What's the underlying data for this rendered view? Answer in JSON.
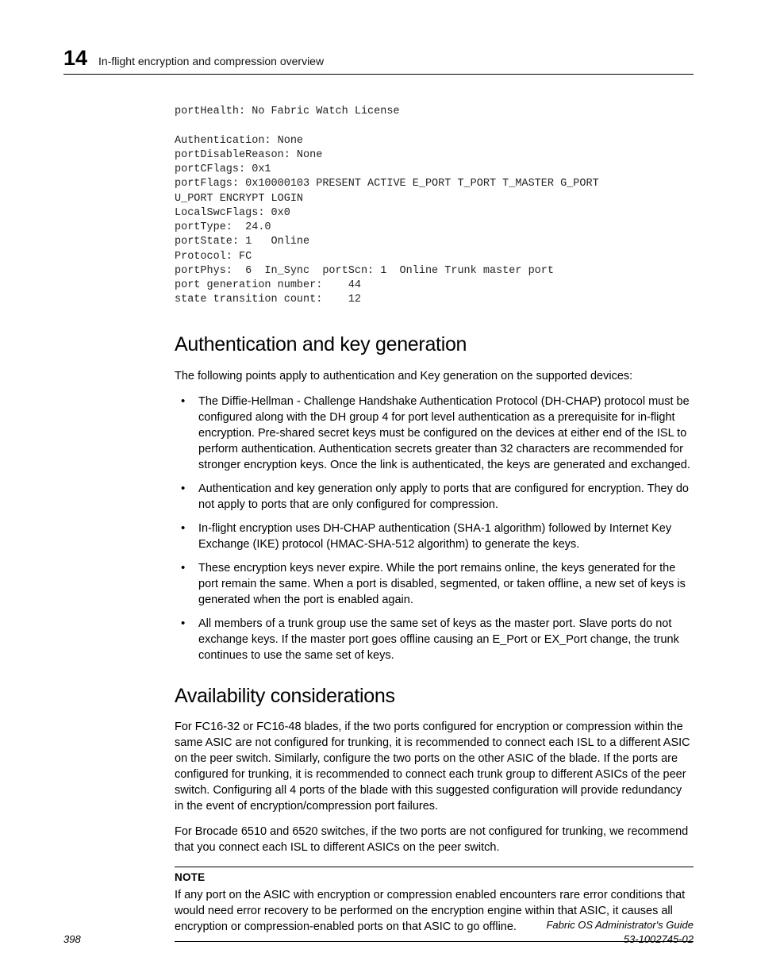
{
  "header": {
    "chapter_number": "14",
    "chapter_title": "In-flight encryption and compression overview"
  },
  "code": "portHealth: No Fabric Watch License\n\nAuthentication: None\nportDisableReason: None\nportCFlags: 0x1\nportFlags: 0x10000103 PRESENT ACTIVE E_PORT T_PORT T_MASTER G_PORT\nU_PORT ENCRYPT LOGIN\nLocalSwcFlags: 0x0\nportType:  24.0\nportState: 1   Online\nProtocol: FC\nportPhys:  6  In_Sync  portScn: 1  Online Trunk master port\nport generation number:    44\nstate transition count:    12",
  "section1": {
    "heading": "Authentication and key generation",
    "intro": "The following points apply to authentication and Key generation on the supported devices:",
    "bullets": [
      "The Diffie-Hellman - Challenge Handshake Authentication Protocol (DH-CHAP) protocol must be configured along with the DH group 4 for port level authentication as a prerequisite for in-flight encryption. Pre-shared secret keys must be configured on the devices at either end of the ISL to perform authentication. Authentication secrets greater than 32 characters are recommended for stronger encryption keys. Once the link is authenticated, the keys are generated and exchanged.",
      "Authentication and key generation only apply to ports that are configured for encryption. They do not apply to ports that are only configured for compression.",
      "In-flight encryption uses DH-CHAP authentication (SHA-1 algorithm) followed by Internet Key Exchange (IKE) protocol (HMAC-SHA-512 algorithm) to generate the keys.",
      "These encryption keys never expire. While the port remains online, the keys generated for the port remain the same. When a port is disabled, segmented, or taken offline, a new set of keys is generated when the port is enabled again.",
      "All members of a trunk group use the same set of keys as the master port. Slave ports do not exchange keys. If the master port goes offline causing an E_Port or EX_Port change, the trunk continues to use the same set of keys."
    ]
  },
  "section2": {
    "heading": "Availability considerations",
    "para1": "For FC16-32 or FC16-48 blades, if the two ports configured for encryption or compression within the same ASIC are not configured for trunking, it is recommended to connect each ISL to a different ASIC on the peer switch. Similarly, configure the two ports on the other ASIC of the blade. If the ports are configured for trunking, it is recommended to connect each trunk group to different ASICs of the peer switch.   Configuring all 4 ports of the blade with this suggested configuration will provide redundancy in the event of encryption/compression port failures.",
    "para2": "For Brocade 6510 and 6520 switches, if the two ports are not configured for trunking, we recommend that you connect each ISL to different ASICs on the peer switch.",
    "note_label": "NOTE",
    "note_body": "If any port on the ASIC with encryption or compression enabled encounters rare error conditions that would need error recovery to be performed on the encryption engine within that ASIC, it causes all encryption or compression-enabled ports on that ASIC to go offline."
  },
  "footer": {
    "page": "398",
    "book": "Fabric OS Administrator's Guide",
    "docnum": "53-1002745-02"
  }
}
